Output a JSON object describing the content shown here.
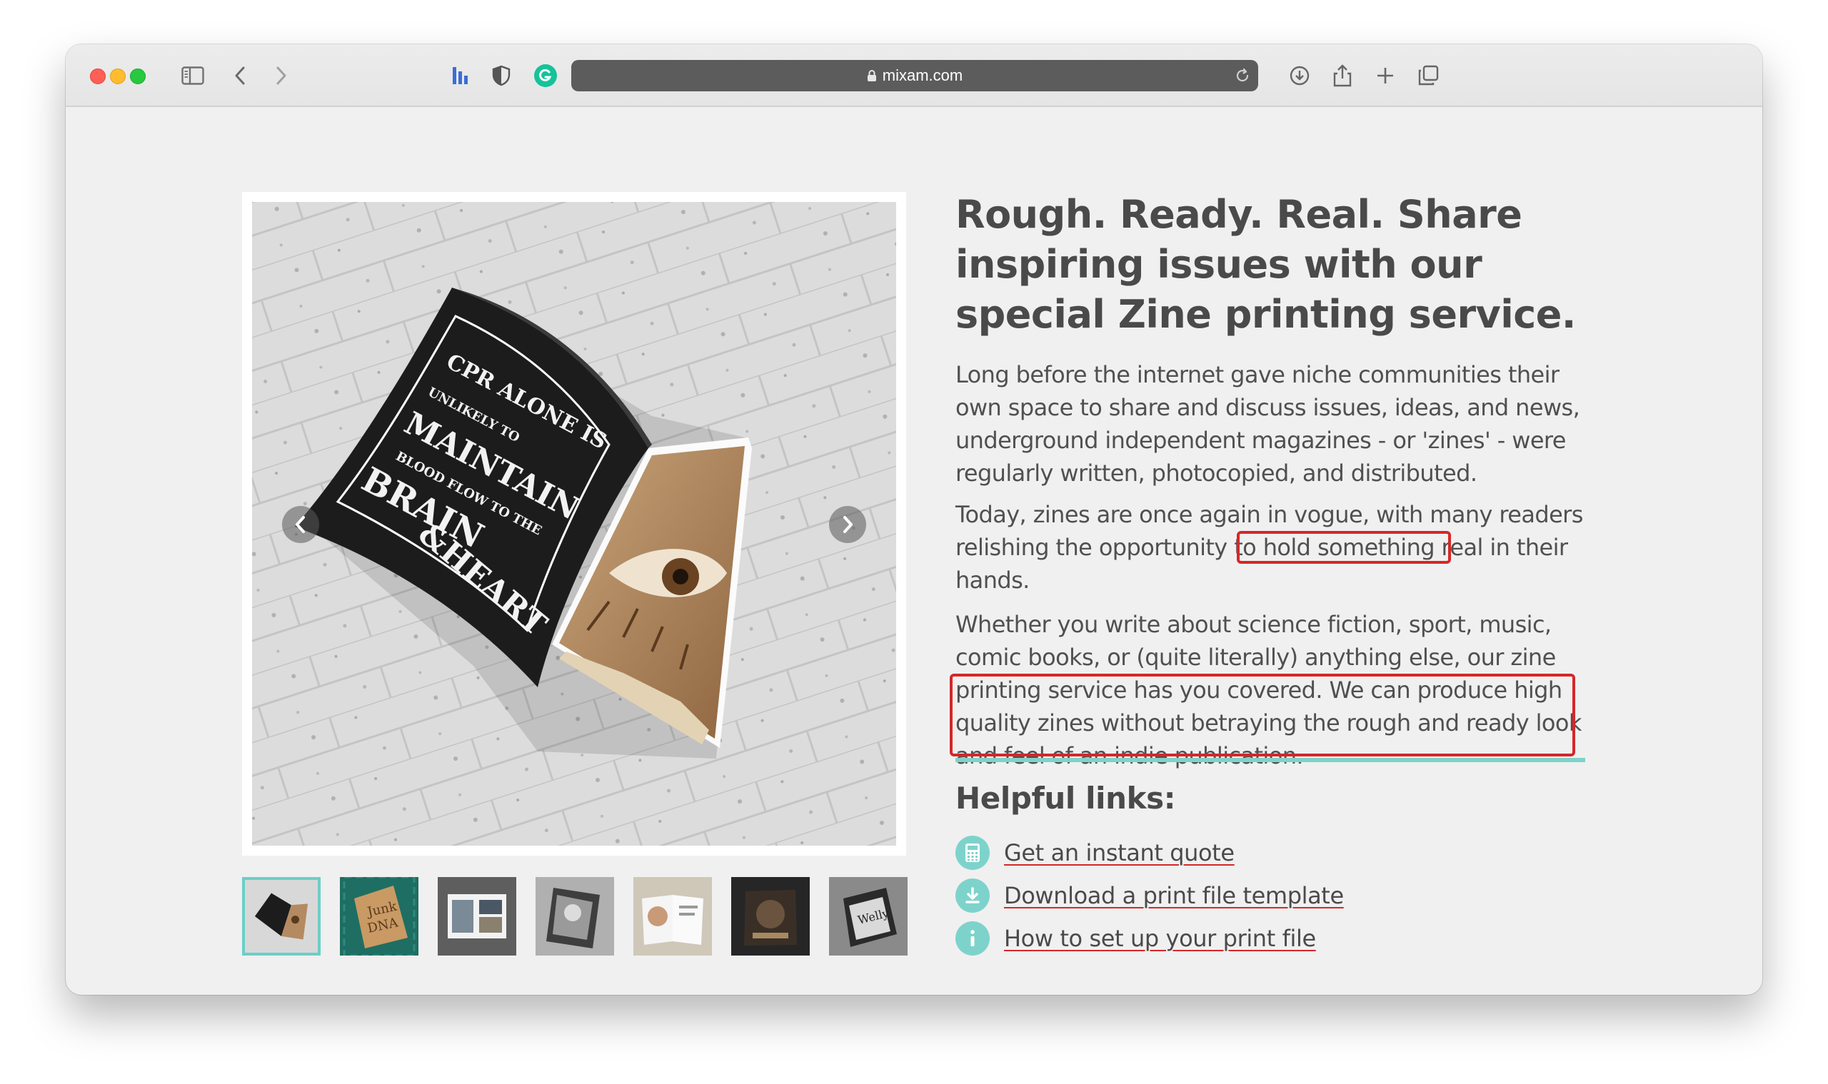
{
  "browser": {
    "url": "mixam.com"
  },
  "article": {
    "headline": "Rough. Ready. Real. Share inspiring issues with our special Zine printing service.",
    "paragraph1": "Long before the internet gave niche communities their own space to share and discuss issues, ideas, and news, underground independent magazines - or 'zines' - were regularly written, photocopied, and distributed.",
    "paragraph2": "Today, zines are once again in vogue, with many readers relishing the opportunity to hold something real in their hands.",
    "paragraph3": "Whether you write about science fiction, sport, music, comic books, or (quite literally) anything else, our zine printing service has you covered. We can produce high quality zines without betraying the rough and ready look and feel of an indie publication."
  },
  "helpful_links": {
    "title": "Helpful links:",
    "items": [
      {
        "label": "Get an instant quote",
        "icon": "calculator-icon"
      },
      {
        "label": "Download a print file template",
        "icon": "download-icon"
      },
      {
        "label": "How to set up your print file",
        "icon": "info-icon"
      }
    ]
  },
  "gallery": {
    "zine_lettering": "CPR ALONE IS UNLIKELY TO MAINTAIN BLOOD FLOW TO THE BRAIN & HEART",
    "thumbnail_count": 7,
    "active_index": 0
  },
  "colors": {
    "accent": "#7dd3cb",
    "highlight": "#d62728",
    "text": "#505050"
  }
}
